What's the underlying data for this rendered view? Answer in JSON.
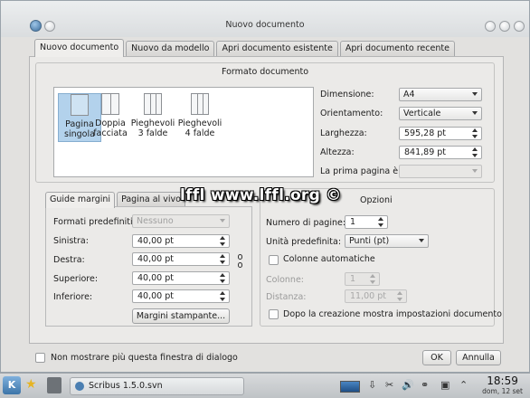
{
  "window": {
    "title": "Nuovo documento"
  },
  "tabs": [
    "Nuovo documento",
    "Nuovo da modello",
    "Apri documento esistente",
    "Apri documento recente"
  ],
  "formato": {
    "title": "Formato documento",
    "layouts": [
      {
        "label": "Pagina singola",
        "icon": "single-page-icon",
        "selected": true
      },
      {
        "label": "Doppia facciata",
        "icon": "double-page-icon",
        "selected": false
      },
      {
        "label": "Pieghevoli 3 falde",
        "icon": "trifold-icon",
        "selected": false
      },
      {
        "label": "Pieghevoli 4 falde",
        "icon": "fourfold-icon",
        "selected": false
      }
    ],
    "dimensione_label": "Dimensione:",
    "dimensione_value": "A4",
    "orientamento_label": "Orientamento:",
    "orientamento_value": "Verticale",
    "larghezza_label": "Larghezza:",
    "larghezza_value": "595,28 pt",
    "altezza_label": "Altezza:",
    "altezza_value": "841,89 pt",
    "prima_pagina_label": "La prima pagina è:",
    "prima_pagina_value": ""
  },
  "margini": {
    "tabs": [
      "Guide margini",
      "Pagina al vivo"
    ],
    "predefiniti_label": "Formati predefiniti:",
    "predefiniti_value": "Nessuno",
    "sinistra_label": "Sinistra:",
    "sinistra_value": "40,00 pt",
    "destra_label": "Destra:",
    "destra_value": "40,00 pt",
    "superiore_label": "Superiore:",
    "superiore_value": "40,00 pt",
    "inferiore_label": "Inferiore:",
    "inferiore_value": "40,00 pt",
    "stampante_button": "Margini stampante..."
  },
  "opzioni": {
    "title": "Opzioni",
    "pagine_label": "Numero di pagine:",
    "pagine_value": "1",
    "unita_label": "Unità predefinita:",
    "unita_value": "Punti (pt)",
    "colonne_auto_label": "Colonne automatiche",
    "colonne_label": "Colonne:",
    "colonne_value": "1",
    "distanza_label": "Distanza:",
    "distanza_value": "11,00 pt",
    "mostra_impostazioni_label": "Dopo la creazione mostra impostazioni documento"
  },
  "footer": {
    "non_mostrare_label": "Non mostrare più questa finestra di dialogo",
    "ok": "OK",
    "annulla": "Annulla"
  },
  "watermark": "lffl www.lffl.org ©",
  "taskbar": {
    "task_label": "Scribus 1.5.0.svn",
    "time": "18:59",
    "date": "dom, 12 set"
  }
}
